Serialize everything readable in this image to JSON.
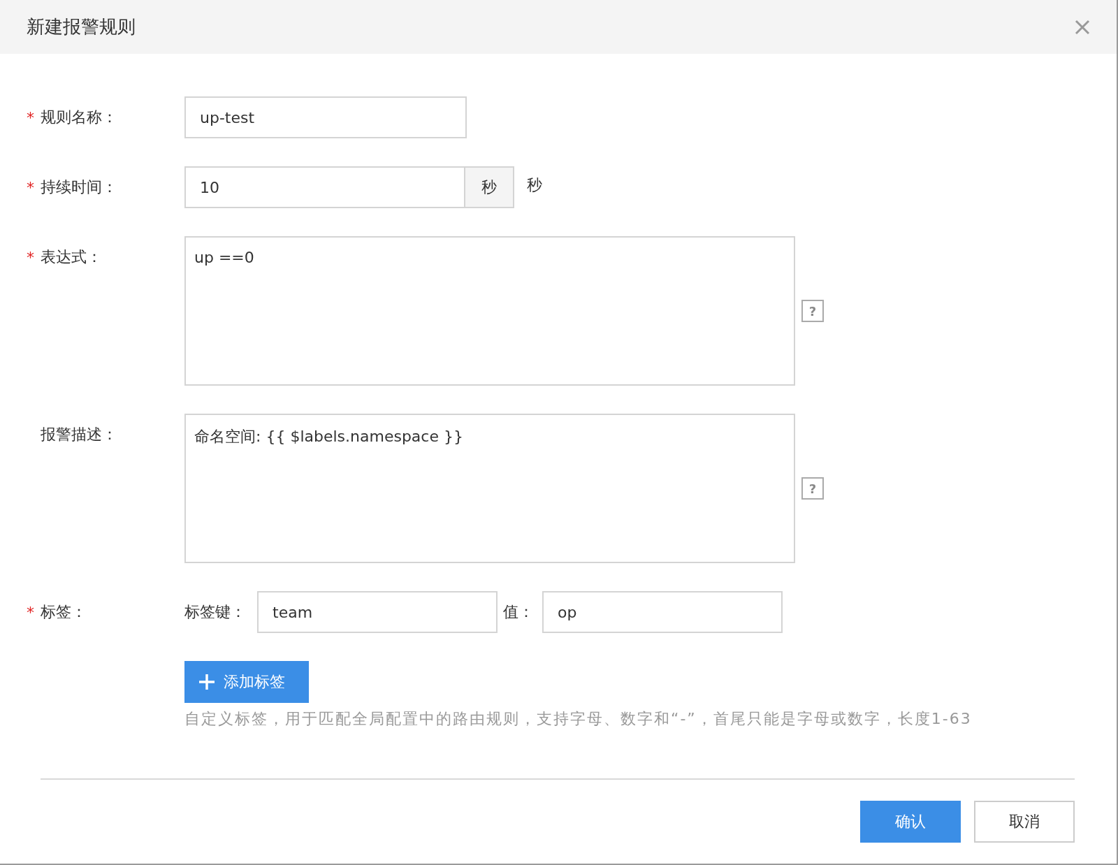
{
  "dialog": {
    "title": "新建报警规则"
  },
  "required_mark": "*",
  "fields": [
    {
      "kind": "text",
      "label": "规则名称：",
      "required": true,
      "value": "up-test"
    },
    {
      "kind": "suffix",
      "label": "持续时间：",
      "required": true,
      "value": "10",
      "suffix": "秒",
      "unit": "秒"
    },
    {
      "kind": "textarea",
      "label": "表达式：",
      "required": true,
      "value": "up ==0",
      "help": "?"
    },
    {
      "kind": "textarea",
      "label": "报警描述：",
      "required": false,
      "value": "命名空间: {{ $labels.namespace }}",
      "help": "?"
    },
    {
      "kind": "tags",
      "label": "标签：",
      "required": true,
      "key_label": "标签键：",
      "key_value": "team",
      "value_label": "值：",
      "value": "op"
    }
  ],
  "add_button": "添加标签",
  "hint": "自定义标签，用于匹配全局配置中的路由规则，支持字母、数字和“-”，首尾只能是字母或数字，长度1-63",
  "buttons": [
    {
      "label": "确认",
      "kind": "primary"
    },
    {
      "label": "取消",
      "kind": "default"
    }
  ]
}
